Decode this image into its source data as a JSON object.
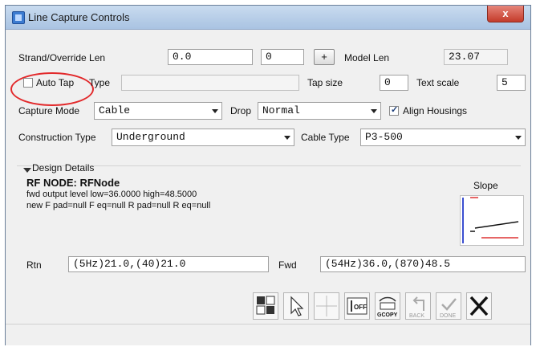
{
  "window": {
    "title": "Line Capture Controls",
    "close_glyph": "x"
  },
  "strand": {
    "label": "Strand/Override Len",
    "value1": "0.0",
    "value2": "0",
    "plus_label": "+",
    "model_len_label": "Model Len",
    "model_len_value": "23.07"
  },
  "tap": {
    "auto_tap_label": "Auto Tap",
    "auto_tap_checked": false,
    "type_label": "Type",
    "type_value": "",
    "tap_size_label": "Tap size",
    "tap_size_value": "0",
    "text_scale_label": "Text scale",
    "text_scale_value": "5"
  },
  "capture": {
    "mode_label": "Capture Mode",
    "mode_value": "Cable",
    "drop_label": "Drop",
    "drop_value": "Normal",
    "align_label": "Align Housings",
    "align_checked": true
  },
  "construction": {
    "type_label": "Construction Type",
    "type_value": "Underground",
    "cable_type_label": "Cable Type",
    "cable_type_value": "P3-500"
  },
  "design": {
    "header": "Design Details",
    "node_title": "RF NODE: RFNode",
    "line1": "fwd output level low=36.0000 high=48.5000",
    "line2": "new F pad=null F eq=null R pad=null R eq=null",
    "slope_label": "Slope",
    "rtn_label": "Rtn",
    "rtn_value": "(5Hz)21.0,(40)21.0",
    "fwd_label": "Fwd",
    "fwd_value": "(54Hz)36.0,(870)48.5"
  },
  "toolbar": {
    "off_label": "OFF",
    "gcopy_label": "GCOPY",
    "back_label": "BACK",
    "done_label": "DONE"
  },
  "colors": {
    "titlebar": "#b9cfe9",
    "close": "#c9463a",
    "highlight_circle": "#e2292b"
  }
}
